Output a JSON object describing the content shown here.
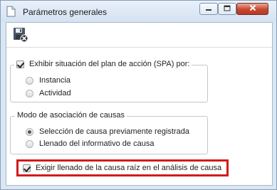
{
  "window": {
    "title": "Parámetros generales",
    "controls": {
      "minimize": "minimize",
      "maximize": "maximize",
      "close": "close"
    }
  },
  "toolbar": {
    "save_icon": "save-and-close-icon"
  },
  "spa_group": {
    "checkbox_label": "Exhibir situación del plan de acción (SPA) por:",
    "checked": true,
    "options": [
      {
        "label": "Instancia",
        "selected": false
      },
      {
        "label": "Actividad",
        "selected": false
      }
    ]
  },
  "cause_group": {
    "legend": "Modo de asociación de causas",
    "options": [
      {
        "label": "Selección de causa previamente registrada",
        "selected": true
      },
      {
        "label": "Llenado del informativo de causa",
        "selected": false
      }
    ]
  },
  "root_cause": {
    "label": "Exigir llenado de la causa raíz en el análisis de causa",
    "checked": true
  },
  "colors": {
    "highlight": "#d21b1b",
    "title_bar": "#d9e6f4",
    "close_button": "#c9452f"
  }
}
